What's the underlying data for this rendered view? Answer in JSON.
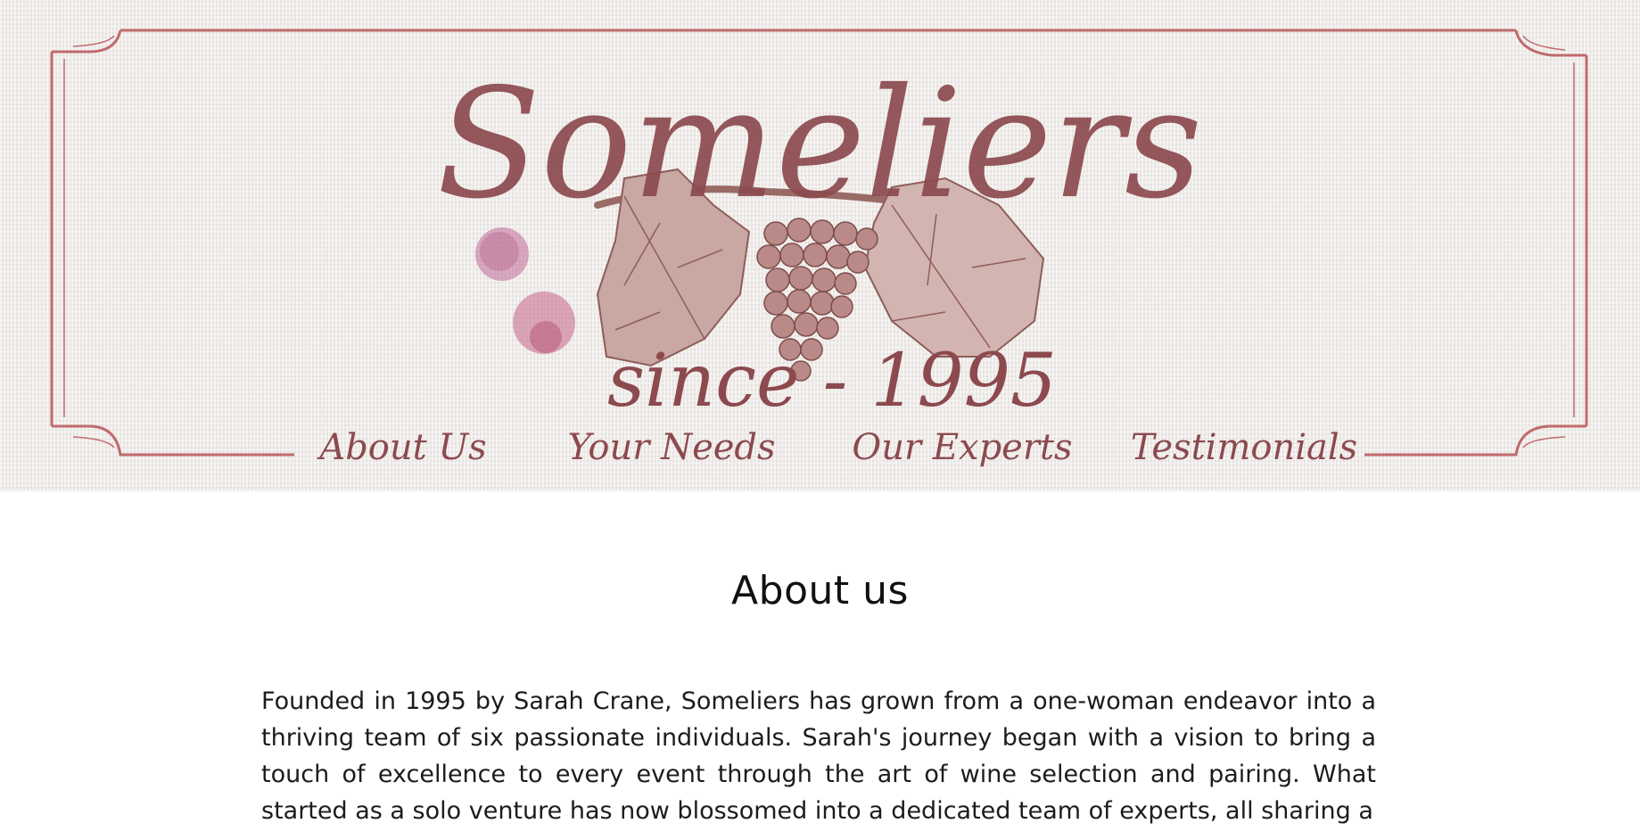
{
  "brand": {
    "name": "Someliers",
    "tagline": "since - 1995"
  },
  "nav": {
    "items": [
      {
        "label": "About Us"
      },
      {
        "label": "Your Needs"
      },
      {
        "label": "Our Experts"
      },
      {
        "label": "Testimonials"
      }
    ]
  },
  "about": {
    "title": "About us",
    "text": "Founded in 1995 by Sarah Crane, Someliers has grown from a one-woman endeavor into a thriving team of six passionate individuals. Sarah's journey began with a vision to bring a touch of excellence to every event through the art of wine selection and pairing. What started as a solo venture has now blossomed into a dedicated team of experts, all sharing a"
  },
  "colors": {
    "brand_burgundy": "#8c4a4e",
    "frame_rose": "#c16a6d",
    "paper": "#efebe8",
    "wine_stain": "#c06a98"
  },
  "icons": [
    "grape-vine-icon",
    "wine-stain-icon"
  ]
}
